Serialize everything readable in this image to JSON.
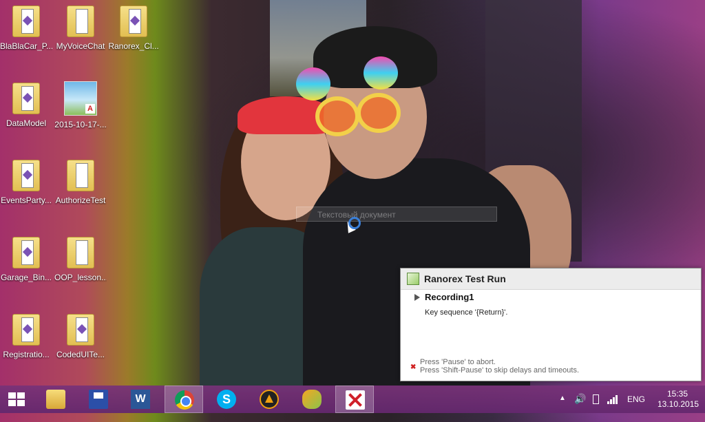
{
  "desktop": {
    "icons": [
      {
        "label": "BlaBlaCar_P...",
        "type": "folder"
      },
      {
        "label": "MyVoiceChat",
        "type": "folder"
      },
      {
        "label": "Ranorex_Cl...",
        "type": "folder"
      },
      {
        "label": "DataModel",
        "type": "folder"
      },
      {
        "label": "2015-10-17-...",
        "type": "pdf"
      },
      {
        "label": "EventsParty...",
        "type": "folder"
      },
      {
        "label": "AuthorizeTest",
        "type": "folder"
      },
      {
        "label": "Garage_Bin...",
        "type": "folder"
      },
      {
        "label": "OOP_lesson...",
        "type": "folder"
      },
      {
        "label": "Registratio...",
        "type": "folder"
      },
      {
        "label": "CodedUITe...",
        "type": "folder"
      }
    ],
    "ghost_text": "Текстовый документ"
  },
  "notification": {
    "title": "Ranorex Test Run",
    "recording": "Recording1",
    "message": "Key sequence '{Return}'.",
    "hint_abort": "Press 'Pause' to abort.",
    "hint_skip": "Press 'Shift-Pause' to skip delays and timeouts."
  },
  "taskbar": {
    "apps": [
      {
        "name": "file-explorer"
      },
      {
        "name": "save"
      },
      {
        "name": "word",
        "glyph": "W"
      },
      {
        "name": "chrome",
        "active": true
      },
      {
        "name": "skype",
        "glyph": "S"
      },
      {
        "name": "aimp"
      },
      {
        "name": "fl-studio"
      },
      {
        "name": "ranorex",
        "active": true
      }
    ],
    "tray": {
      "chevron": "▲",
      "volume": "🔊",
      "language": "ENG",
      "time": "15:35",
      "date": "13.10.2015"
    }
  }
}
